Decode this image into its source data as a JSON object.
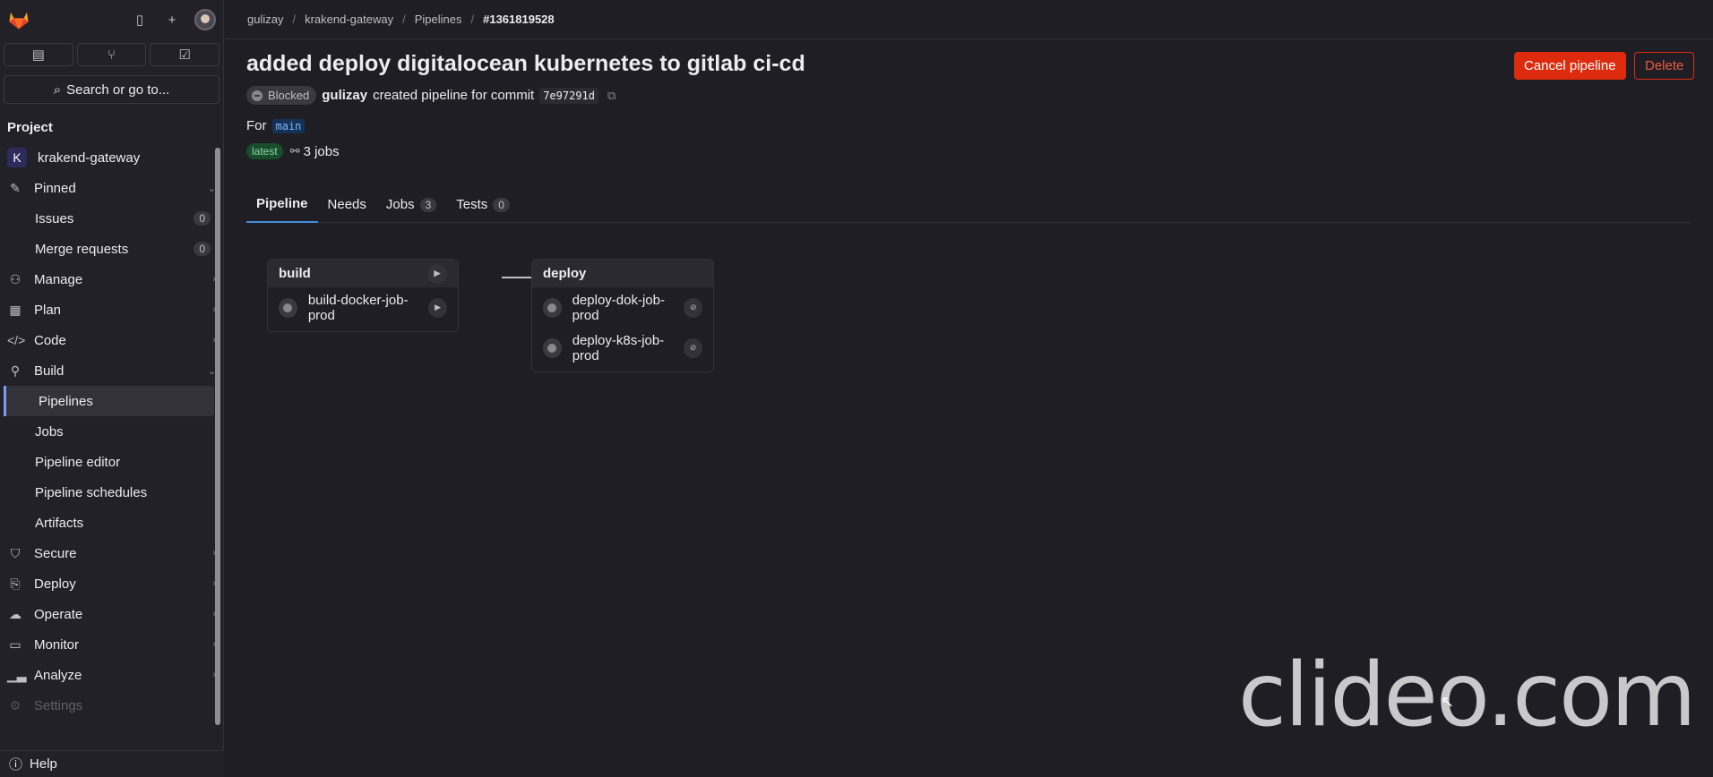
{
  "sidebar": {
    "search_label": "Search or go to...",
    "section": "Project",
    "project": {
      "initial": "K",
      "name": "krakend-gateway"
    },
    "pinned": {
      "label": "Pinned",
      "items": [
        {
          "label": "Issues",
          "count": "0"
        },
        {
          "label": "Merge requests",
          "count": "0"
        }
      ]
    },
    "manage": "Manage",
    "plan": "Plan",
    "code": "Code",
    "build": {
      "label": "Build",
      "items": [
        "Pipelines",
        "Jobs",
        "Pipeline editor",
        "Pipeline schedules",
        "Artifacts"
      ]
    },
    "secure": "Secure",
    "deploy": "Deploy",
    "operate": "Operate",
    "monitor": "Monitor",
    "analyze": "Analyze",
    "settings": "Settings",
    "help": "Help"
  },
  "breadcrumb": [
    "gulizay",
    "krakend-gateway",
    "Pipelines",
    "#1361819528"
  ],
  "header": {
    "title": "added deploy digitalocean kubernetes to gitlab ci-cd",
    "cancel_label": "Cancel pipeline",
    "delete_label": "Delete",
    "status": "Blocked",
    "author": "gulizay",
    "created_text": "created pipeline for commit",
    "commit": "7e97291d",
    "for_label": "For",
    "branch": "main",
    "latest_badge": "latest",
    "jobs_text": "3 jobs"
  },
  "tabs": [
    {
      "label": "Pipeline"
    },
    {
      "label": "Needs"
    },
    {
      "label": "Jobs",
      "count": "3"
    },
    {
      "label": "Tests",
      "count": "0"
    }
  ],
  "stages": [
    {
      "name": "build",
      "jobs": [
        "build-docker-job-prod"
      ]
    },
    {
      "name": "deploy",
      "jobs": [
        "deploy-dok-job-prod",
        "deploy-k8s-job-prod"
      ]
    }
  ],
  "watermark": "clideo.com",
  "colors": {
    "danger": "#dd2b0e",
    "accent": "#428fdc",
    "background": "#1f1e24"
  }
}
